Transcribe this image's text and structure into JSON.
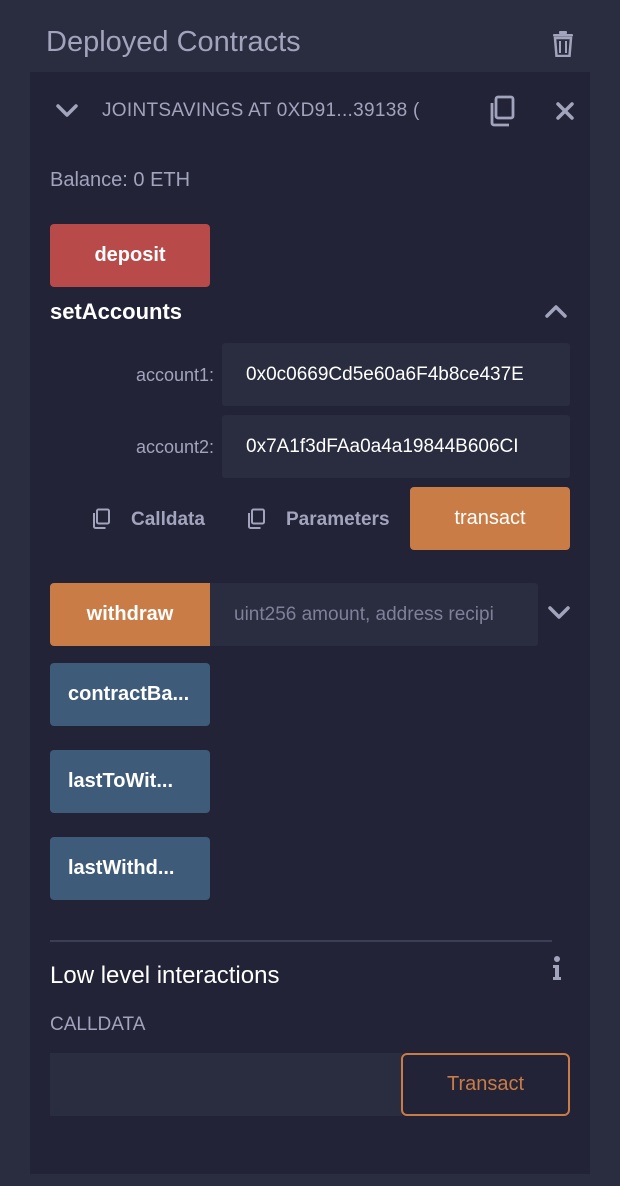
{
  "header": {
    "title": "Deployed Contracts"
  },
  "contract": {
    "title": "JOINTSAVINGS AT 0XD91...39138 (",
    "balance": "Balance: 0 ETH"
  },
  "functions": {
    "deposit": "deposit",
    "setAccounts": {
      "label": "setAccounts",
      "params": [
        {
          "label": "account1:",
          "value": "0x0c0669Cd5e60a6F4b8ce437E"
        },
        {
          "label": "account2:",
          "value": "0x7A1f3dFAa0a4a19844B606CI"
        }
      ],
      "calldata_label": "Calldata",
      "parameters_label": "Parameters",
      "transact_label": "transact"
    },
    "withdraw": {
      "label": "withdraw",
      "placeholder": "uint256 amount, address recipi"
    },
    "views": [
      "contractBa...",
      "lastToWit...",
      "lastWithd..."
    ]
  },
  "low_level": {
    "title": "Low level interactions",
    "calldata_label": "CALLDATA",
    "transact_label": "Transact"
  },
  "colors": {
    "deposit": "#b84a4a",
    "transact": "#c97c45",
    "call": "#3f5b7a"
  }
}
